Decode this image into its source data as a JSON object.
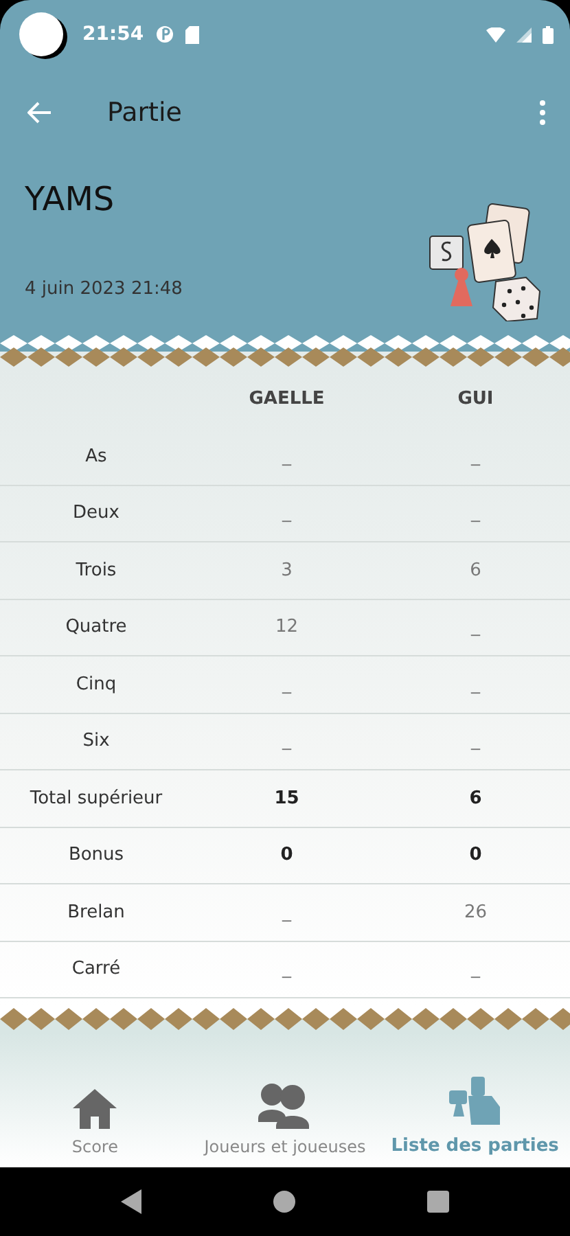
{
  "status_bar": {
    "time": "21:54"
  },
  "app_bar": {
    "title": "Partie"
  },
  "game": {
    "name": "YAMS",
    "date": "4 juin 2023 21:48"
  },
  "table": {
    "players": [
      "GAELLE",
      "GUI"
    ],
    "rows": [
      {
        "label": "As",
        "kind": "score",
        "values": [
          "_",
          "_"
        ]
      },
      {
        "label": "Deux",
        "kind": "score",
        "values": [
          "_",
          "_"
        ]
      },
      {
        "label": "Trois",
        "kind": "score",
        "values": [
          "3",
          "6"
        ]
      },
      {
        "label": "Quatre",
        "kind": "score",
        "values": [
          "12",
          "_"
        ]
      },
      {
        "label": "Cinq",
        "kind": "score",
        "values": [
          "_",
          "_"
        ]
      },
      {
        "label": "Six",
        "kind": "score",
        "values": [
          "_",
          "_"
        ]
      },
      {
        "label": "Total supérieur",
        "kind": "total",
        "values": [
          "15",
          "6"
        ]
      },
      {
        "label": "Bonus",
        "kind": "total",
        "values": [
          "0",
          "0"
        ]
      },
      {
        "label": "Brelan",
        "kind": "score",
        "values": [
          "_",
          "26"
        ]
      },
      {
        "label": "Carré",
        "kind": "score",
        "values": [
          "_",
          "_"
        ]
      }
    ]
  },
  "bottom_nav": [
    {
      "label": "Score",
      "kind": "home",
      "selected": false
    },
    {
      "label": "Joueurs et joueuses",
      "kind": "players",
      "selected": false
    },
    {
      "label": "Liste des parties",
      "kind": "list",
      "selected": true
    }
  ]
}
